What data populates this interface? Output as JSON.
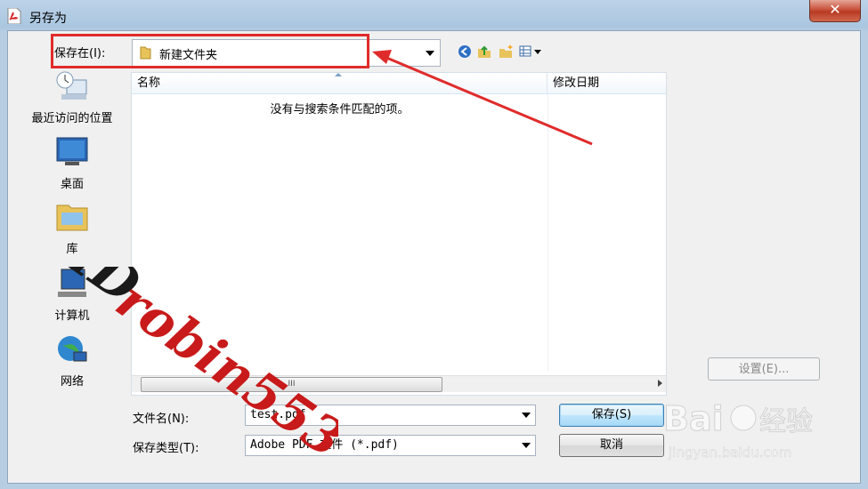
{
  "window": {
    "title": "另存为",
    "close_label": "✕"
  },
  "toolbar": {
    "save_in_label": "保存在(I):",
    "save_in_value": "新建文件夹",
    "icons": [
      "back-icon",
      "up-folder-icon",
      "new-folder-icon",
      "view-menu-icon"
    ]
  },
  "places": [
    {
      "label": "最近访问的位置",
      "icon": "recent-places-icon"
    },
    {
      "label": "桌面",
      "icon": "desktop-icon"
    },
    {
      "label": "库",
      "icon": "libraries-icon"
    },
    {
      "label": "计算机",
      "icon": "computer-icon"
    },
    {
      "label": "网络",
      "icon": "network-icon"
    }
  ],
  "file_list": {
    "columns": [
      "名称",
      "修改日期"
    ],
    "empty_message": "没有与搜索条件匹配的项。",
    "scroll_grip": "III"
  },
  "settings_button": "设置(E)...",
  "filename": {
    "label": "文件名(N):",
    "value": "test.pdf"
  },
  "filetype": {
    "label": "保存类型(T):",
    "value": "Adobe PDF 文件 (*.pdf)"
  },
  "buttons": {
    "save": "保存(S)",
    "cancel": "取消"
  },
  "annotation": {
    "color": "#e02b2b"
  },
  "watermarks": {
    "handwritten": "IDrobin553",
    "baidu_logo": "Baidu",
    "baidu_text": "经验",
    "baidu_url": "jingyan.baidu.com"
  }
}
